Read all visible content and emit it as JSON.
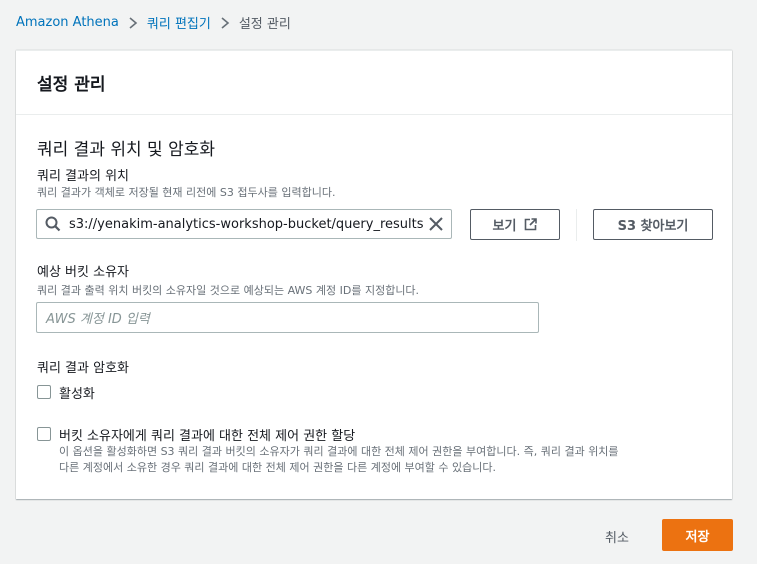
{
  "breadcrumb": {
    "items": [
      "Amazon Athena",
      "쿼리 편집기"
    ],
    "current": "설정 관리"
  },
  "panel": {
    "title": "설정 관리",
    "section_title": "쿼리 결과 위치 및 암호화",
    "result_location": {
      "label": "쿼리 결과의 위치",
      "description": "쿼리 결과가 객체로 저장될 현재 리전에 S3 접두사를 입력합니다.",
      "value": "s3://yenakim-analytics-workshop-bucket/query_results",
      "view_button": "보기",
      "browse_button": "S3 찾아보기"
    },
    "bucket_owner": {
      "label": "예상 버킷 소유자",
      "description": "쿼리 결과 출력 위치 버킷의 소유자일 것으로 예상되는 AWS 계정 ID를 지정합니다.",
      "placeholder": "AWS 계정 ID 입력"
    },
    "encryption": {
      "label": "쿼리 결과 암호화",
      "checkbox_label": "활성화"
    },
    "full_control": {
      "checkbox_label": "버킷 소유자에게 쿼리 결과에 대한 전체 제어 권한 할당",
      "description_line1": "이 옵션을 활성화하면 S3 쿼리 결과 버킷의 소유자가 쿼리 결과에 대한 전체 제어 권한을 부여합니다. 즉, 쿼리 결과 위치를",
      "description_line2": "다른 계정에서 소유한 경우 쿼리 결과에 대한 전체 제어 권한을 다른 계정에 부여할 수 있습니다."
    }
  },
  "footer": {
    "cancel_label": "취소",
    "save_label": "저장"
  },
  "colors": {
    "link": "#0073bb",
    "primary": "#ec7211",
    "background": "#f2f3f3"
  }
}
